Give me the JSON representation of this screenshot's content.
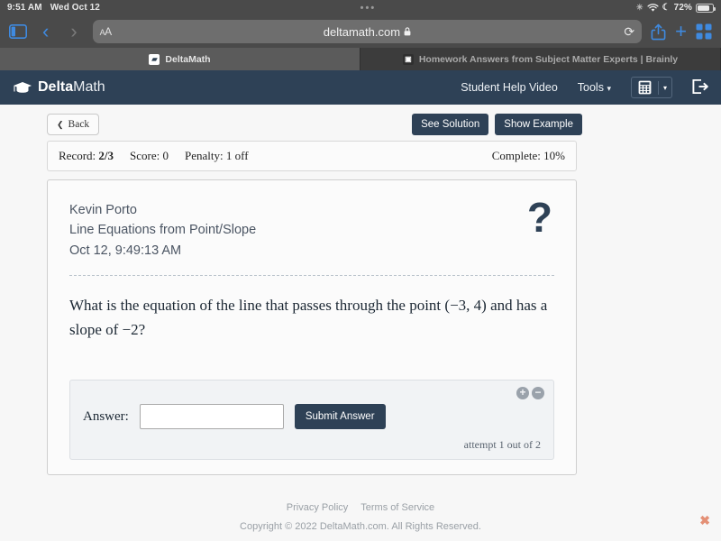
{
  "ios": {
    "time": "9:51 AM",
    "date": "Wed Oct 12",
    "center_dots": "•••",
    "battery_percent": "72%",
    "icons": {
      "brightness": "☀",
      "wifi": "wifi-icon",
      "moon": "☾"
    }
  },
  "safari": {
    "sidebar_icon": "sidebar-icon",
    "back_arrow": "‹",
    "forward_arrow": "›",
    "aa_label_small": "A",
    "aa_label_large": "A",
    "url": "deltamath.com",
    "lock_icon": "🔒",
    "reload_icon": "⟳",
    "share_icon": "share-icon",
    "new_tab_icon": "+",
    "tabs_icon": "tabs-icon",
    "tabs": [
      {
        "title": "DeltaMath",
        "favicon": "deltamath-favicon",
        "active": true
      },
      {
        "title": "Homework Answers from Subject Matter Experts | Brainly",
        "favicon": "brainly-favicon",
        "active": false
      }
    ]
  },
  "header": {
    "logo_icon": "graduation-cap-icon",
    "logo_bold": "Delta",
    "logo_light": "Math",
    "student_help_video": "Student Help Video",
    "tools": "Tools",
    "tools_caret": "▾",
    "calculator_icon": "calculator-icon",
    "calculator_caret": "▾",
    "logout_icon": "logout-icon",
    "background_color": "#2e4156"
  },
  "toolbar": {
    "back_label": "Back",
    "back_chevron": "❮",
    "see_solution": "See Solution",
    "show_example": "Show Example"
  },
  "record": {
    "record_label": "Record:",
    "record_value": "2/3",
    "score_label": "Score:",
    "score_value": "0",
    "penalty_label": "Penalty:",
    "penalty_value": "1 off",
    "complete_label": "Complete:",
    "complete_value": "10%"
  },
  "problem": {
    "student_name": "Kevin Porto",
    "assignment_title": "Line Equations from Point/Slope",
    "timestamp": "Oct 12, 9:49:13 AM",
    "help_icon": "?",
    "question_part1": "What is the equation of the line that passes through the point ",
    "question_point": "(−3, 4)",
    "question_part2": " and has a slope of ",
    "question_slope": "−2",
    "question_part3": "?"
  },
  "answer": {
    "label": "Answer:",
    "input_value": "",
    "input_placeholder": "",
    "submit_label": "Submit Answer",
    "zoom_in_icon": "+",
    "zoom_out_icon": "−",
    "attempt_text": "attempt 1 out of 2"
  },
  "footer": {
    "privacy_policy": "Privacy Policy",
    "terms_of_service": "Terms of Service",
    "copyright": "Copyright © 2022 DeltaMath.com. All Rights Reserved.",
    "close_icon": "✖"
  }
}
